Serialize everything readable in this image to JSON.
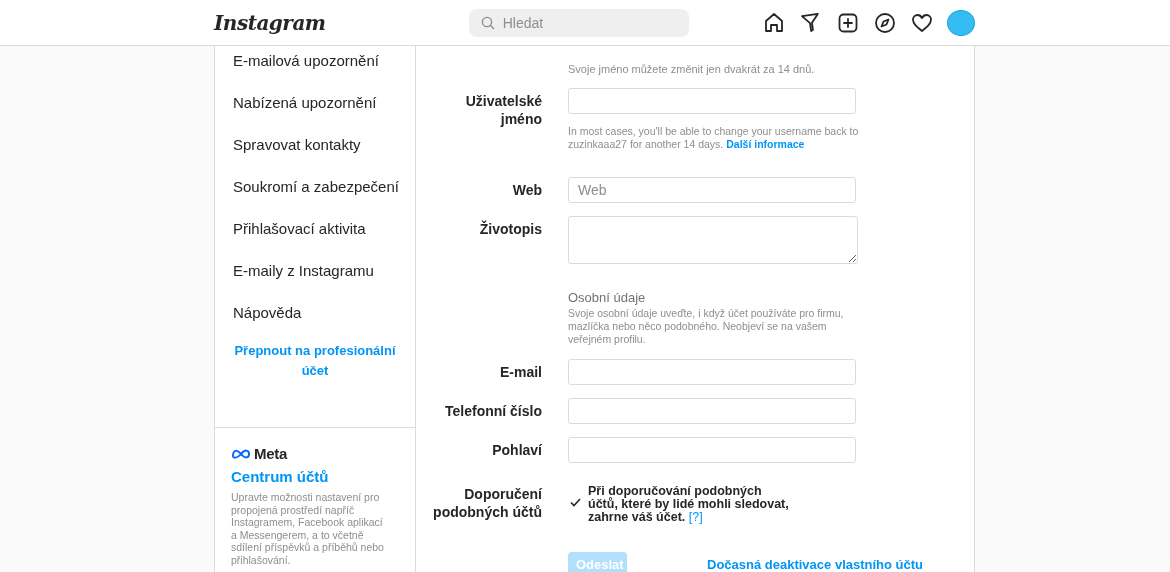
{
  "header": {
    "logo": "Instagram",
    "search": {
      "placeholder": "Hledat"
    }
  },
  "sidebar": {
    "items": [
      {
        "label": "E-mailová upozornění",
        "selected": false
      },
      {
        "label": "Nabízená upozornění",
        "selected": false
      },
      {
        "label": "Spravovat kontakty",
        "selected": false
      },
      {
        "label": "Soukromí a zabezpečení",
        "selected": false
      },
      {
        "label": "Přihlašovací aktivita",
        "selected": false
      },
      {
        "label": "E-maily z Instagramu",
        "selected": false
      },
      {
        "label": "Nápověda",
        "selected": false
      }
    ],
    "switch_link": "Přepnout na profesionální účet",
    "meta": {
      "brand": "Meta",
      "title": "Centrum účtů",
      "text": "Upravte možnosti nastavení pro propojená prostředí napříč Instagramem, Facebook aplikací a Messengerem, a to včetně sdílení příspěvků a příběhů nebo přihlašování."
    }
  },
  "form": {
    "rows": [
      {
        "kind": "note",
        "text": "Svoje jméno můžete změnit jen dvakrát za 14 dnů."
      },
      {
        "kind": "input",
        "label": "Uživatelské jméno",
        "help": "In most cases, you'll be able to change your username back to zuzinkaaa27 for another 14 days.",
        "help_link": "Další informace"
      },
      {
        "kind": "input",
        "label": "Web",
        "placeholder": "Web"
      },
      {
        "kind": "textarea",
        "label": "Životopis"
      },
      {
        "kind": "section",
        "title": "Osobní údaje",
        "text": "Svoje osobní údaje uveďte, i když účet používáte pro firmu, mazlíčka nebo něco podobného. Neobjeví se na vašem veřejném profilu."
      },
      {
        "kind": "input",
        "label": "E-mail"
      },
      {
        "kind": "input",
        "label": "Telefonní číslo"
      },
      {
        "kind": "input",
        "label": "Pohlaví"
      },
      {
        "kind": "checkbox",
        "label": "Doporučení podobných účtů",
        "text": "Při doporučování podobných účtů, které by lidé mohli sledovat, zahrne váš účet.",
        "help_link": "[?]",
        "checked": true
      }
    ],
    "submit": {
      "label": "Odeslat",
      "disabled": true
    },
    "deactivate_link": "Dočasná deaktivace vlastního účtu"
  }
}
